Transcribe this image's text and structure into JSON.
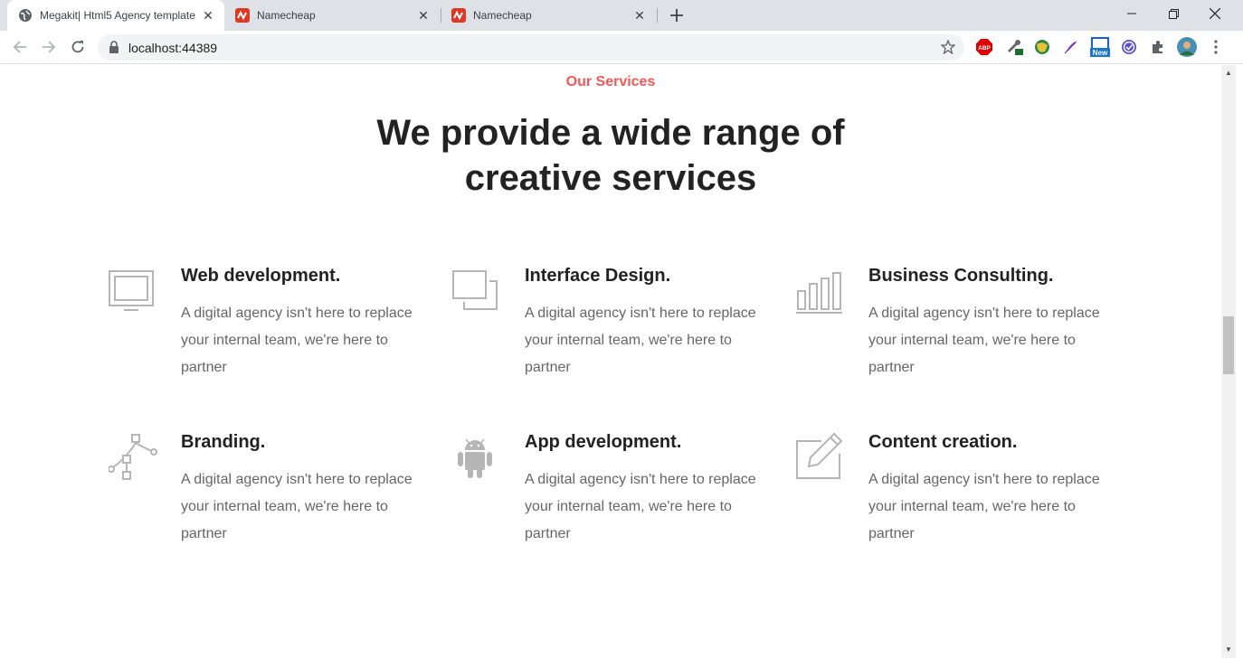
{
  "browser": {
    "tabs": [
      {
        "title": "Megakit| Html5 Agency template",
        "active": true,
        "favicon": "globe-icon"
      },
      {
        "title": "Namecheap",
        "active": false,
        "favicon": "namecheap-icon"
      },
      {
        "title": "Namecheap",
        "active": false,
        "favicon": "namecheap-icon"
      }
    ],
    "url": "localhost:44389",
    "extensions": [
      "abp-icon",
      "puzzle-green-icon",
      "globe-ext-icon",
      "feather-icon",
      "new-badge-icon",
      "check-circle-icon",
      "puzzle-icon",
      "profile-avatar"
    ],
    "new_badge": "New",
    "abp_label": "ABP"
  },
  "page": {
    "section_subtitle": "Our Services",
    "section_title": "We provide a wide range of creative services",
    "services": [
      {
        "title": "Web development.",
        "text": "A digital agency isn't here to replace your internal team, we're here to partner",
        "icon": "monitor-icon"
      },
      {
        "title": "Interface Design.",
        "text": "A digital agency isn't here to replace your internal team, we're here to partner",
        "icon": "layers-icon"
      },
      {
        "title": "Business Consulting.",
        "text": "A digital agency isn't here to replace your internal team, we're here to partner",
        "icon": "bar-chart-icon"
      },
      {
        "title": "Branding.",
        "text": "A digital agency isn't here to replace your internal team, we're here to partner",
        "icon": "vector-pen-icon"
      },
      {
        "title": "App development.",
        "text": "A digital agency isn't here to replace your internal team, we're here to partner",
        "icon": "android-icon"
      },
      {
        "title": "Content creation.",
        "text": "A digital agency isn't here to replace your internal team, we're here to partner",
        "icon": "edit-icon"
      }
    ]
  },
  "colors": {
    "accent": "#f75757",
    "heading": "#222222",
    "body_text": "#666666",
    "icon": "#b5b5b5",
    "tabstrip": "#dee1e6"
  }
}
